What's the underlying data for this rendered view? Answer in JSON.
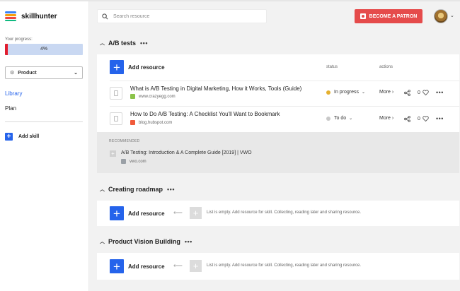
{
  "app": {
    "name": "skillhunter"
  },
  "sidebar": {
    "progress_label": "Your progress:",
    "progress_value": 0.04,
    "progress_text": "4%",
    "skill_select": "Product",
    "nav": [
      {
        "label": "Library",
        "active": true
      },
      {
        "label": "Plan",
        "active": false
      }
    ],
    "add_skill": "Add skill"
  },
  "header": {
    "search_placeholder": "Search resource",
    "patron_button": "BECOME A PATRON",
    "accent_color": "#e54b4b"
  },
  "sections": [
    {
      "title": "A/B tests",
      "add_label": "Add resource",
      "columns": {
        "status": "status",
        "actions": "actions"
      },
      "rows": [
        {
          "title": "What is A/B Testing in Digital Marketing, How it Works, Tools (Guide)",
          "source": "www.crazyegg.com",
          "status": "In progress",
          "status_color": "#e5b02f",
          "more": "More",
          "likes": "0"
        },
        {
          "title": "How to Do A/B Testing: A Checklist You'll Want to Bookmark",
          "source": "blog.hubspot.com",
          "status": "To do",
          "status_color": "#c8c8c8",
          "more": "More",
          "likes": "0"
        }
      ],
      "recommended": {
        "label": "RECOMMENDED",
        "title": "A/B Testing: Introduction & A Complete Guide [2019] | VWO",
        "source": "vwo.com"
      }
    },
    {
      "title": "Creating roadmap",
      "add_label": "Add resource",
      "empty_text": "List is empty. Add resource for skill. Collecting, reading later and sharing resource."
    },
    {
      "title": "Product Vision Building",
      "add_label": "Add resource",
      "empty_text": "List is empty. Add resource for skill. Collecting, reading later and sharing resource."
    }
  ],
  "icons": {
    "logo": "skillhunter-logo-icon",
    "search": "search-icon",
    "patron": "patreon-icon",
    "share": "share-icon",
    "like": "heart-icon",
    "more": "kebab-icon"
  }
}
